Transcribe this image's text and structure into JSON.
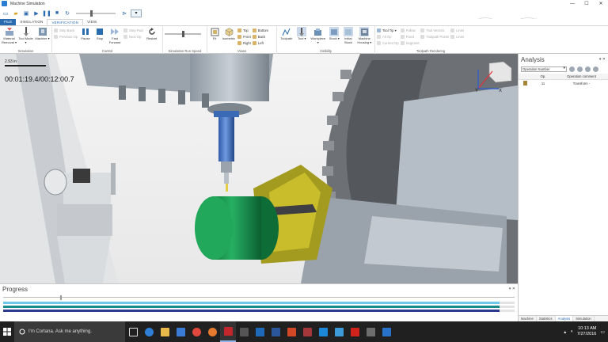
{
  "window": {
    "title": "Machine Simulation",
    "controls": [
      "—",
      "☐",
      "✕"
    ]
  },
  "tabs": [
    {
      "label": "FILE"
    },
    {
      "label": "SIMULATION"
    },
    {
      "label": "VERIFICATION"
    },
    {
      "label": "VIEW"
    }
  ],
  "ribbon": {
    "simulation": {
      "label": "Simulation",
      "material_removal": "Material Removal ▾",
      "tool_mode": "Tool Mode ▾",
      "machine": "Machine ▾"
    },
    "control": {
      "label": "Control",
      "step_back": "Step Back",
      "previous_op": "Previous Op",
      "pause": "Pause",
      "stop": "Stop",
      "fast_forward": "Fast Forward",
      "step_fwd": "Step Fwd",
      "next_op": "Next Op",
      "restart": "Restart"
    },
    "run_speed": {
      "label": "Simulation Run Speed"
    },
    "views": {
      "label": "Views",
      "fit": "Fit",
      "isometric": "Isometric",
      "top": "Top",
      "front": "Front",
      "right": "Right",
      "bottom": "Bottom",
      "back": "Back",
      "left": "Left"
    },
    "visibility": {
      "label": "Visibility",
      "toolpath": "Toolpath",
      "tool": "Tool ▾",
      "workpiece": "Workpiece ▾",
      "stock": "Stock ▾",
      "initial_stock": "Initial Stock",
      "machine_housing": "Machine Housing ▾"
    },
    "toolpath_rendering": {
      "label": "Toolpath Rendering",
      "tool_tip": "Tool Tip ▾",
      "all_op": "All Op",
      "current_op": "Current Op",
      "follow": "Follow",
      "fixed": "Fixed",
      "segment": "Segment",
      "tool_vectors": "Tool Vectors",
      "toolpath_points": "Toolpath Points",
      "lines": "Lines",
      "lines2": "Lines"
    }
  },
  "viewport": {
    "scale_label": "2.93 in",
    "timer": "00:01:19.4/00:12:00.7"
  },
  "analysis": {
    "title": "Analysis",
    "panel_controls": "▾ ✕",
    "sort_select": "Operation Number",
    "columns": {
      "op": "Op.",
      "comment": "Operation comment"
    },
    "rows": [
      {
        "op": "11",
        "comment": "Transform -",
        "swatch": "#a8843a"
      }
    ],
    "tabs": [
      "Machine",
      "Statistics",
      "Analysis",
      "Simulation"
    ]
  },
  "progress": {
    "title": "Progress",
    "panel_controls": "▾ ✕",
    "tracks": [
      {
        "color": "#6fc8e8",
        "fraction": 0.97
      },
      {
        "color": "#1c8a8c",
        "fraction": 0.97
      },
      {
        "color": "#2b3a8f",
        "fraction": 0.97
      }
    ]
  },
  "taskbar": {
    "search_placeholder": "I'm Cortana. Ask me anything.",
    "time": "10:13 AM",
    "date": "7/27/2016"
  }
}
